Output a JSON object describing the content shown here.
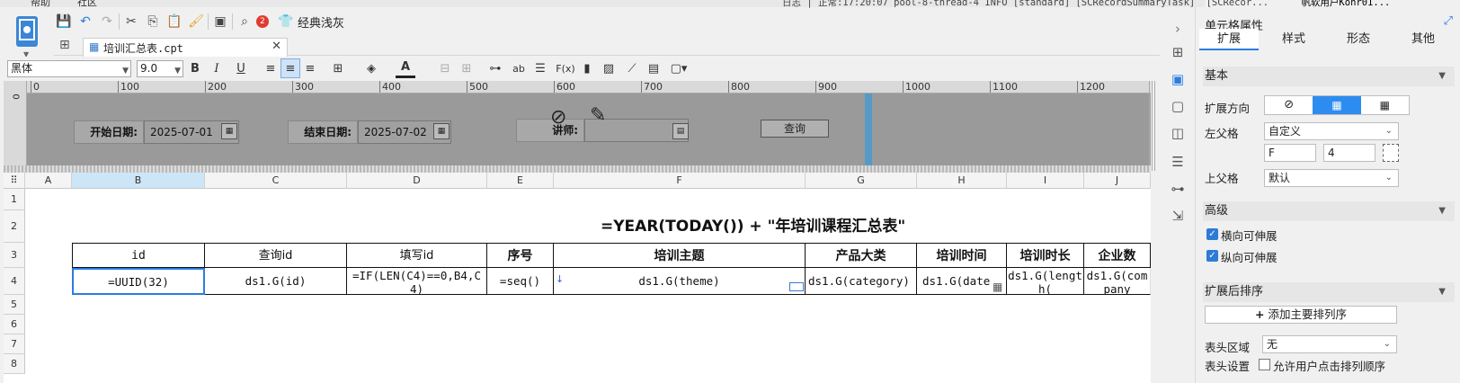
{
  "menubar": {
    "items": [
      "帮助",
      "社区"
    ]
  },
  "log_text": "日志 | 正常:17:20:07 pool-8-thread-4 INFO [standard] [SCRecordSummaryTask]",
  "log_right": "[SCRecor...",
  "user_label": "帆软用户Kohr01...",
  "toolbar": {
    "template_style_label": "经典浅灰",
    "badge_count": "2"
  },
  "tab": {
    "filename": "培训汇总表.cpt"
  },
  "format": {
    "font_name": "黑体",
    "font_size": "9.0"
  },
  "ruler": {
    "marks": [
      "0",
      "100",
      "200",
      "300",
      "400",
      "500",
      "600",
      "700",
      "800",
      "900",
      "1000",
      "1100",
      "1200"
    ]
  },
  "params": {
    "start_label": "开始日期:",
    "start_value": "2025-07-01",
    "end_label": "结束日期:",
    "end_value": "2025-07-02",
    "lecturer_label": "讲师:",
    "query_button": "查询"
  },
  "grid": {
    "columns": [
      "A",
      "B",
      "C",
      "D",
      "E",
      "F",
      "G",
      "H",
      "I",
      "J"
    ],
    "rows": [
      "1",
      "2",
      "3",
      "4",
      "5",
      "6",
      "7",
      "8"
    ],
    "title_formula": "=YEAR(TODAY()) + \"年培训课程汇总表\"",
    "headers": [
      "id",
      "查询id",
      "填写id",
      "序号",
      "培训主题",
      "产品大类",
      "培训时间",
      "培训时长",
      "企业数"
    ],
    "formulas": [
      "=UUID(32)",
      "ds1.G(id)",
      "=IF(LEN(C4)==0,B4,C4)",
      "=seq()",
      "ds1.G(theme)",
      "ds1.G(category)",
      "ds1.G(date",
      "ds1.G(length(",
      "ds1.G(company"
    ]
  },
  "props": {
    "title": "单元格属性",
    "tabs": [
      "扩展",
      "样式",
      "形态",
      "其他"
    ],
    "basic": "基本",
    "expand_dir": "扩展方向",
    "left_parent": "左父格",
    "left_parent_value": "自定义",
    "left_col": "F",
    "left_row": "4",
    "up_parent": "上父格",
    "up_parent_value": "默认",
    "advanced": "高级",
    "h_expand": "横向可伸展",
    "v_expand": "纵向可伸展",
    "sort_after": "扩展后排序",
    "add_sort": "添加主要排列序",
    "header_area": "表头区域",
    "header_area_value": "无",
    "header_setting": "表头设置",
    "allow_sort": "允许用户点击排列顺序"
  }
}
